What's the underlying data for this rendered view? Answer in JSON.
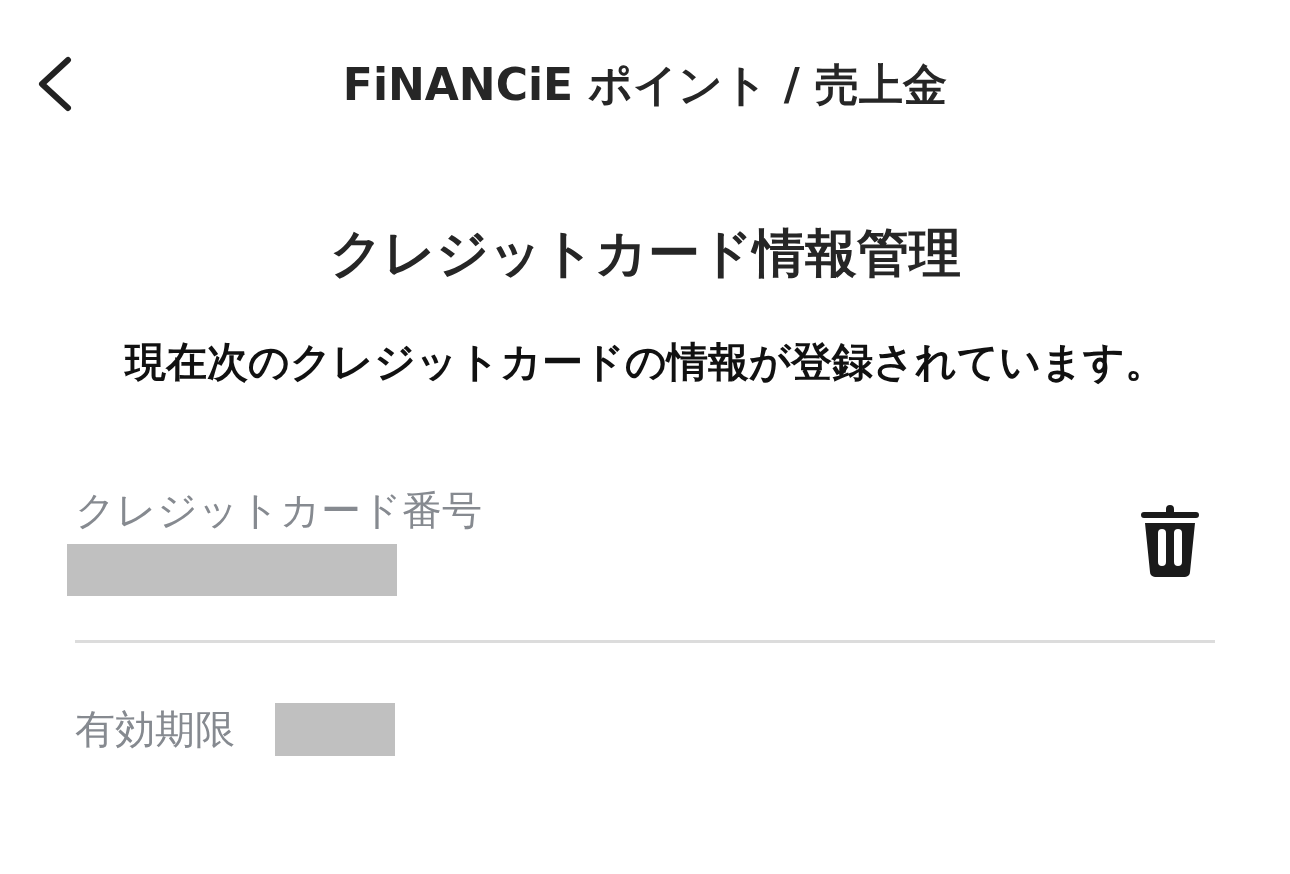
{
  "header": {
    "title": "FiNANCiE ポイント / 売上金"
  },
  "page": {
    "heading": "クレジットカード情報管理",
    "message": "現在次のクレジットカードの情報が登録されています。"
  },
  "card_number": {
    "label": "クレジットカード番号",
    "redacted": true
  },
  "expiry": {
    "label": "有効期限",
    "redacted": true
  }
}
